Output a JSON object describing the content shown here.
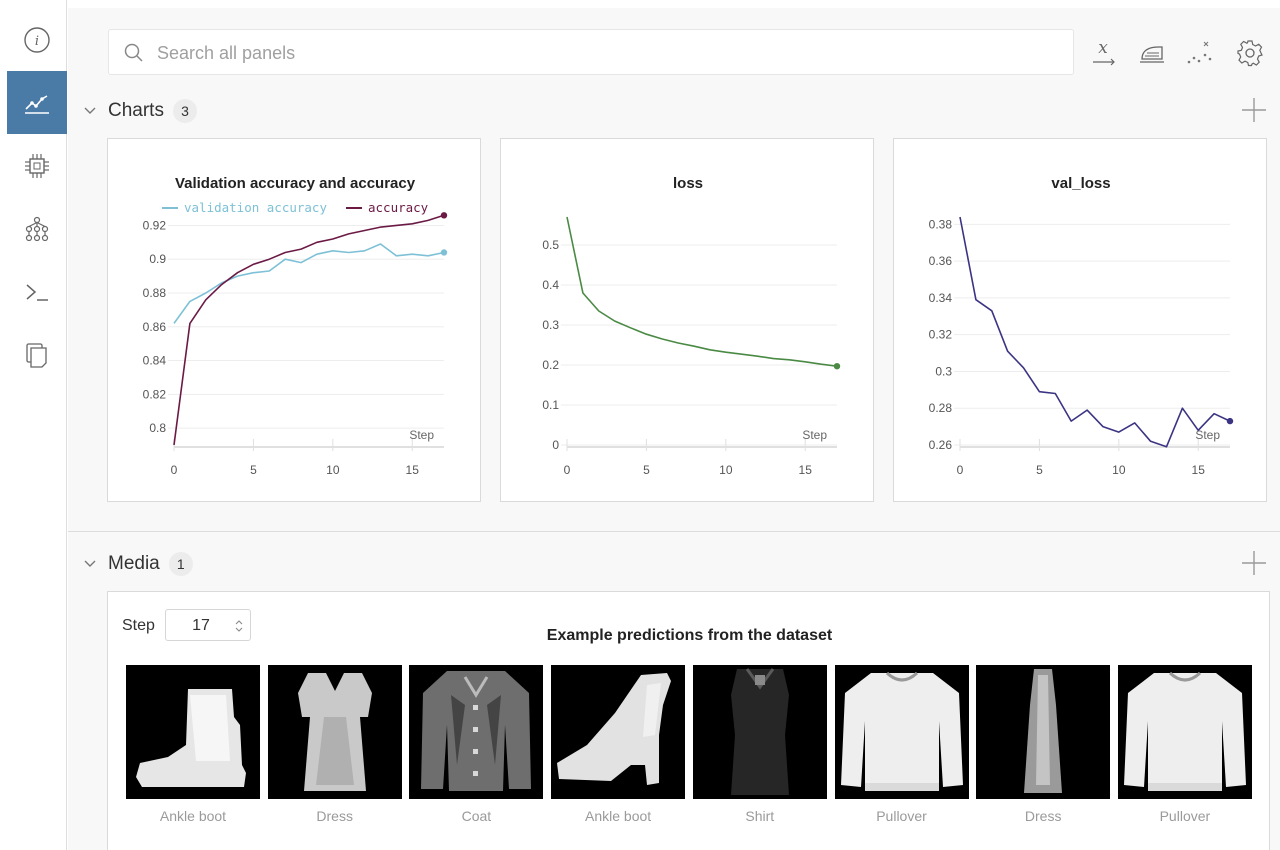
{
  "search": {
    "placeholder": "Search all panels"
  },
  "sidebar": {
    "items": [
      {
        "name": "info-icon",
        "active": false
      },
      {
        "name": "charts-icon",
        "active": true
      },
      {
        "name": "chip-icon",
        "active": false
      },
      {
        "name": "model-graph-icon",
        "active": false
      },
      {
        "name": "terminal-icon",
        "active": false
      },
      {
        "name": "files-icon",
        "active": false
      }
    ]
  },
  "toolbar": {
    "icons": [
      "x-axis-icon",
      "smoothing-icon",
      "outliers-icon",
      "settings-icon"
    ]
  },
  "sections": {
    "charts": {
      "title": "Charts",
      "count": "3"
    },
    "media": {
      "title": "Media",
      "count": "1"
    }
  },
  "colors": {
    "accent": "#4a7ba6",
    "val_accuracy": "#7ec1d6",
    "accuracy": "#6b1a45",
    "loss": "#4a8a44",
    "val_loss": "#3b3483"
  },
  "chart_data": [
    {
      "type": "line",
      "title": "Validation accuracy and accuracy",
      "xlabel": "Step",
      "ylabel": "",
      "xlim": [
        0,
        17
      ],
      "ylim": [
        0.79,
        0.925
      ],
      "xticks": [
        0,
        5,
        10,
        15
      ],
      "yticks": [
        0.8,
        0.82,
        0.84,
        0.86,
        0.88,
        0.9,
        0.92
      ],
      "ytick_labels": [
        "0.8",
        "0.82",
        "0.84",
        "0.86",
        "0.88",
        "0.9",
        "0.92"
      ],
      "legend": "top",
      "series": [
        {
          "name": "validation accuracy",
          "color": "#7ec1d6",
          "x": [
            0,
            1,
            2,
            3,
            4,
            5,
            6,
            7,
            8,
            9,
            10,
            11,
            12,
            13,
            14,
            15,
            16,
            17
          ],
          "values": [
            0.862,
            0.875,
            0.88,
            0.886,
            0.89,
            0.892,
            0.893,
            0.9,
            0.898,
            0.903,
            0.905,
            0.904,
            0.905,
            0.909,
            0.902,
            0.903,
            0.902,
            0.904
          ]
        },
        {
          "name": "accuracy",
          "color": "#6b1a45",
          "x": [
            0,
            1,
            2,
            3,
            4,
            5,
            6,
            7,
            8,
            9,
            10,
            11,
            12,
            13,
            14,
            15,
            16,
            17
          ],
          "values": [
            0.79,
            0.862,
            0.876,
            0.885,
            0.892,
            0.897,
            0.9,
            0.904,
            0.906,
            0.91,
            0.912,
            0.915,
            0.917,
            0.919,
            0.92,
            0.921,
            0.923,
            0.926
          ]
        }
      ]
    },
    {
      "type": "line",
      "title": "loss",
      "xlabel": "Step",
      "ylabel": "",
      "xlim": [
        0,
        17
      ],
      "ylim": [
        0,
        0.57
      ],
      "xticks": [
        0,
        5,
        10,
        15
      ],
      "yticks": [
        0,
        0.1,
        0.2,
        0.3,
        0.4,
        0.5
      ],
      "ytick_labels": [
        "0",
        "0.1",
        "0.2",
        "0.3",
        "0.4",
        "0.5"
      ],
      "series": [
        {
          "color": "#4a8a44",
          "x": [
            0,
            1,
            2,
            3,
            4,
            5,
            6,
            7,
            8,
            9,
            10,
            11,
            12,
            13,
            14,
            15,
            16,
            17
          ],
          "values": [
            0.57,
            0.38,
            0.335,
            0.31,
            0.293,
            0.277,
            0.265,
            0.255,
            0.247,
            0.238,
            0.232,
            0.227,
            0.222,
            0.216,
            0.213,
            0.208,
            0.202,
            0.197
          ]
        }
      ]
    },
    {
      "type": "line",
      "title": "val_loss",
      "xlabel": "Step",
      "ylabel": "",
      "xlim": [
        0,
        17
      ],
      "ylim": [
        0.26,
        0.384
      ],
      "xticks": [
        0,
        5,
        10,
        15
      ],
      "yticks": [
        0.26,
        0.28,
        0.3,
        0.32,
        0.34,
        0.36,
        0.38
      ],
      "ytick_labels": [
        "0.26",
        "0.28",
        "0.3",
        "0.32",
        "0.34",
        "0.36",
        "0.38"
      ],
      "series": [
        {
          "color": "#3b3483",
          "x": [
            0,
            1,
            2,
            3,
            4,
            5,
            6,
            7,
            8,
            9,
            10,
            11,
            12,
            13,
            14,
            15,
            16,
            17
          ],
          "values": [
            0.384,
            0.339,
            0.333,
            0.311,
            0.302,
            0.289,
            0.288,
            0.273,
            0.279,
            0.27,
            0.267,
            0.272,
            0.262,
            0.259,
            0.28,
            0.268,
            0.277,
            0.273
          ]
        }
      ]
    }
  ],
  "media": {
    "step_label": "Step",
    "step_value": "17",
    "title": "Example predictions from the dataset",
    "images": [
      {
        "label": "Ankle boot",
        "kind": "boot"
      },
      {
        "label": "Dress",
        "kind": "dress"
      },
      {
        "label": "Coat",
        "kind": "coat"
      },
      {
        "label": "Ankle boot",
        "kind": "boot2"
      },
      {
        "label": "Shirt",
        "kind": "shirt"
      },
      {
        "label": "Pullover",
        "kind": "pullover"
      },
      {
        "label": "Dress",
        "kind": "thin"
      },
      {
        "label": "Pullover",
        "kind": "pullover"
      }
    ]
  }
}
